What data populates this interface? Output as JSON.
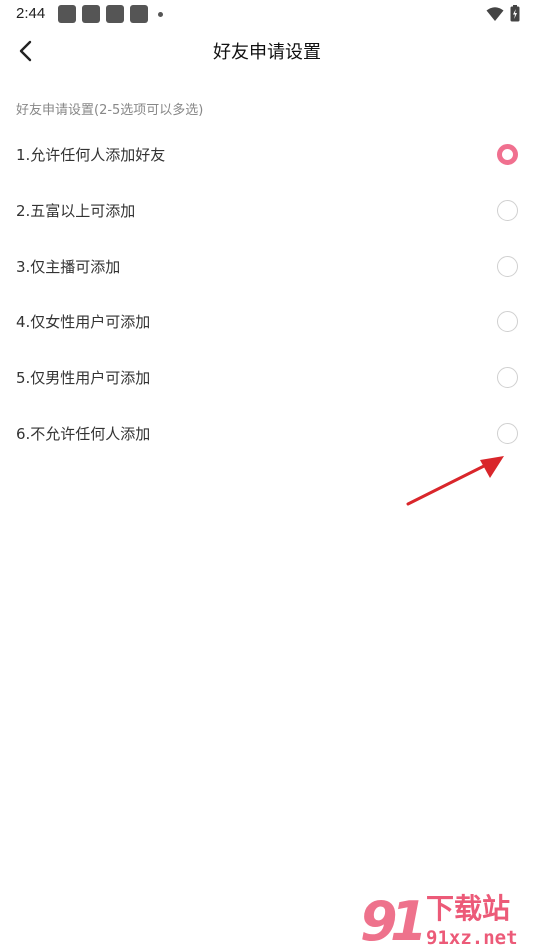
{
  "status_bar": {
    "time": "2:44"
  },
  "header": {
    "title": "好友申请设置"
  },
  "section": {
    "label": "好友申请设置(2-5选项可以多选)"
  },
  "options": [
    {
      "label": "1.允许任何人添加好友",
      "checked": true
    },
    {
      "label": "2.五富以上可添加",
      "checked": false
    },
    {
      "label": "3.仅主播可添加",
      "checked": false
    },
    {
      "label": "4.仅女性用户可添加",
      "checked": false
    },
    {
      "label": "5.仅男性用户可添加",
      "checked": false
    },
    {
      "label": "6.不允许任何人添加",
      "checked": false
    }
  ],
  "watermark": {
    "brand": "下载站",
    "site": "91xz.net"
  },
  "colors": {
    "accent": "#f0708f",
    "arrow": "#d9262b"
  }
}
